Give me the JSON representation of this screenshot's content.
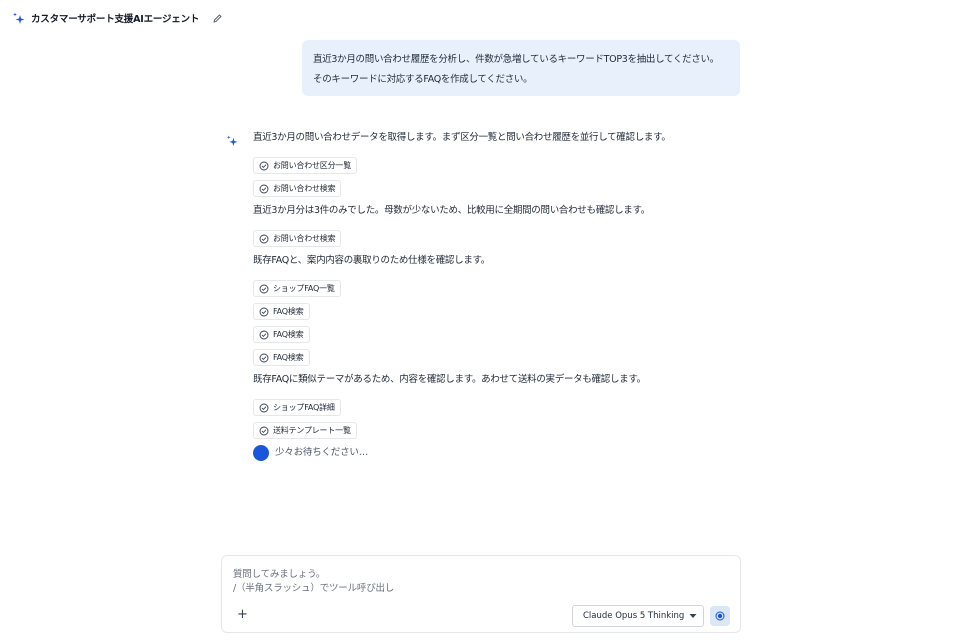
{
  "header": {
    "title": "カスタマーサポート支援AIエージェント",
    "icon": "sparkle-icon",
    "edit_icon": "pencil-icon"
  },
  "user_message": {
    "line1": "直近3か月の問い合わせ履歴を分析し、件数が急増しているキーワードTOP3を抽出してください。",
    "line2": "そのキーワードに対応するFAQを作成してください。"
  },
  "assistant": {
    "text1": "直近3か月の問い合わせデータを取得します。まず区分一覧と問い合わせ履歴を並行して確認します。",
    "tool1": "お問い合わせ区分一覧",
    "tool2": "お問い合わせ検索",
    "text2": "直近3か月分は3件のみでした。母数が少ないため、比較用に全期間の問い合わせも確認します。",
    "tool3": "お問い合わせ検索",
    "text3": "既存FAQと、案内内容の裏取りのため仕様を確認します。",
    "tool4": "ショップFAQ一覧",
    "tool5": "FAQ検索",
    "tool6": "FAQ検索",
    "tool7": "FAQ検索",
    "text4": "既存FAQに類似テーマがあるため、内容を確認します。あわせて送料の実データも確認します。",
    "tool8": "ショップFAQ詳細",
    "tool9": "送料テンプレート一覧",
    "loading": "少々お待ちください…"
  },
  "composer": {
    "placeholder_line1": "質問してみましょう。",
    "placeholder_line2": "/（半角スラッシュ）でツール呼び出し",
    "plus_label": "+",
    "model": "Claude Opus 5 Thinking"
  },
  "colors": {
    "accent": "#1a56db",
    "user_bubble": "#e8f1fb",
    "border": "#e5e7eb"
  }
}
